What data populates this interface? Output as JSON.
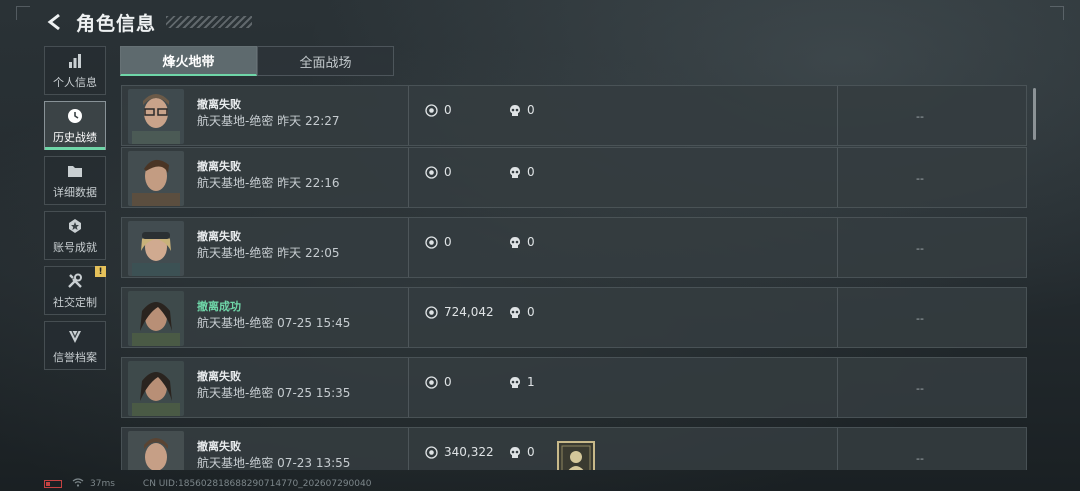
{
  "header": {
    "title": "角色信息"
  },
  "sidebar": {
    "items": [
      {
        "label": "个人信息",
        "icon": "bar-chart-icon",
        "active": false
      },
      {
        "label": "历史战绩",
        "icon": "clock-icon",
        "active": true
      },
      {
        "label": "详细数据",
        "icon": "folder-icon",
        "active": false
      },
      {
        "label": "账号成就",
        "icon": "medal-icon",
        "active": false
      },
      {
        "label": "社交定制",
        "icon": "tools-icon",
        "active": false,
        "badge": "!"
      },
      {
        "label": "信誉档案",
        "icon": "shield-diamond-icon",
        "active": false
      }
    ]
  },
  "tabs": [
    {
      "label": "烽火地带",
      "active": true
    },
    {
      "label": "全面战场",
      "active": false
    }
  ],
  "colors": {
    "accent": "#6fd6a8",
    "success": "#6fd6a8",
    "badge": "#e5c15a"
  },
  "records": [
    {
      "result": "撤离失败",
      "success": false,
      "map": "航天基地-绝密",
      "time": "昨天 22:27",
      "value": "0",
      "kills": "0",
      "rating": "--",
      "avatar": "glasses-man",
      "emblem": false
    },
    {
      "result": "撤离失败",
      "success": false,
      "map": "航天基地-绝密",
      "time": "昨天 22:16",
      "value": "0",
      "kills": "0",
      "rating": "--",
      "avatar": "brown-hair-man",
      "emblem": false
    },
    {
      "result": "撤离失败",
      "success": false,
      "map": "航天基地-绝密",
      "time": "昨天 22:05",
      "value": "0",
      "kills": "0",
      "rating": "--",
      "avatar": "blonde-goggles-woman",
      "emblem": false
    },
    {
      "result": "撤离成功",
      "success": true,
      "map": "航天基地-绝密",
      "time": "07-25 15:45",
      "value": "724,042",
      "kills": "0",
      "rating": "--",
      "avatar": "dark-hair-woman",
      "emblem": false
    },
    {
      "result": "撤离失败",
      "success": false,
      "map": "航天基地-绝密",
      "time": "07-25 15:35",
      "value": "0",
      "kills": "1",
      "rating": "--",
      "avatar": "dark-hair-woman",
      "emblem": false
    },
    {
      "result": "撤离失败",
      "success": false,
      "map": "航天基地-绝密",
      "time": "07-23 13:55",
      "value": "340,322",
      "kills": "0",
      "rating": "--",
      "avatar": "short-hair-man",
      "emblem": true
    }
  ],
  "status_bar": {
    "ping": "37ms",
    "uid": "CN UID:1856028186882907147​70_202607290040"
  }
}
